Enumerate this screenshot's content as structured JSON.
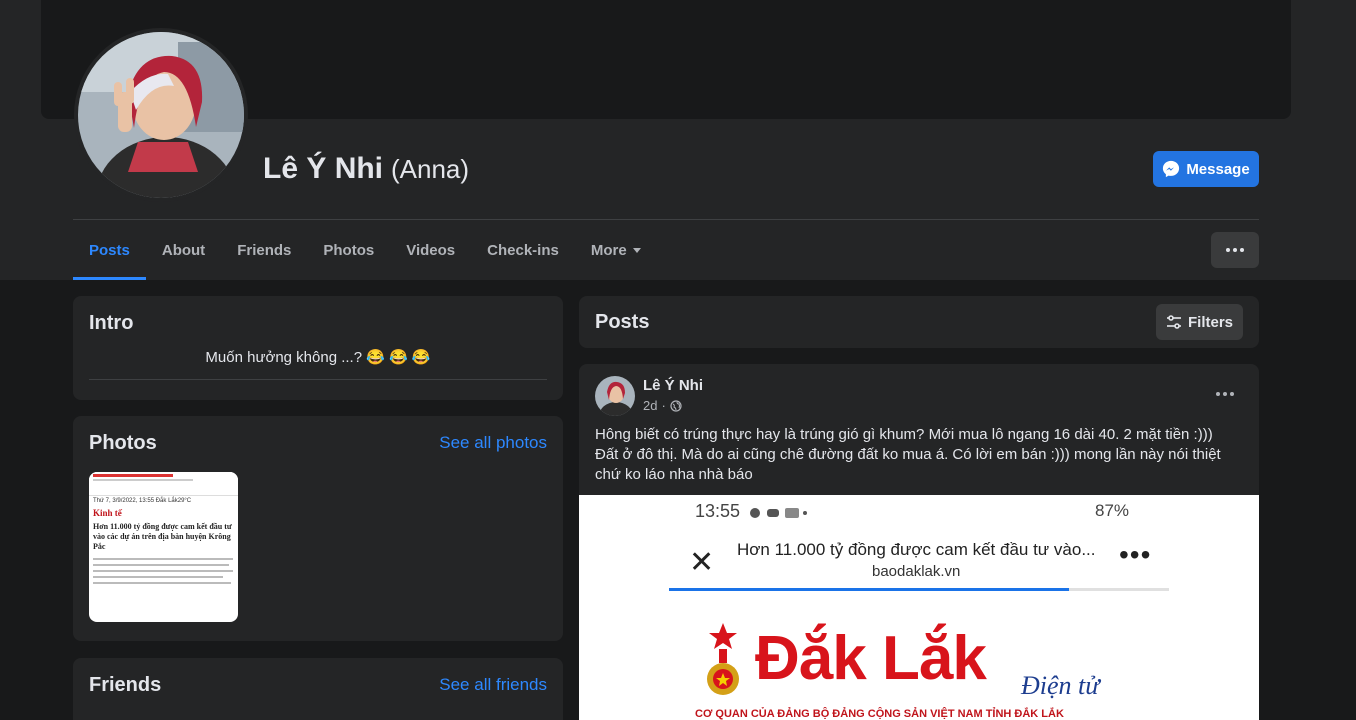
{
  "profile": {
    "name": "Lê Ý Nhi",
    "alt_name": "(Anna)",
    "message_label": "Message"
  },
  "tabs": [
    {
      "label": "Posts",
      "active": true
    },
    {
      "label": "About"
    },
    {
      "label": "Friends"
    },
    {
      "label": "Photos"
    },
    {
      "label": "Videos"
    },
    {
      "label": "Check-ins"
    },
    {
      "label": "More"
    }
  ],
  "intro": {
    "title": "Intro",
    "bio": "Muốn hưởng không ...? 😂 😂 😂"
  },
  "photos": {
    "title": "Photos",
    "see_all": "See all photos",
    "thumb_header": "Thứ 7, 3/9/2022, 13:55  Đắk Lắk29°C",
    "thumb_section": "Kinh tế",
    "thumb_headline": "Hơn 11.000 tỷ đồng được cam kết đầu tư vào các dự án trên địa bàn huyện Krông Pắc"
  },
  "friends": {
    "title": "Friends",
    "see_all": "See all friends"
  },
  "posts_header": {
    "title": "Posts",
    "filters_label": "Filters"
  },
  "post": {
    "author": "Lê Ý Nhi",
    "time": "2d",
    "text": "Hông biết có trúng thực hay là trúng gió gì khum? Mới mua lô ngang 16 dài 40. 2 mặt tiền :))) Đất ở đô thị. Mà do ai cũng chê đường đất ko mua á. Có lời em bán :)))  mong lần này nói thiệt chứ ko láo nha nhà báo",
    "image": {
      "status_time": "13:55",
      "status_right": "87%",
      "page_title": "Hơn 11.000 tỷ đồng được cam kết đầu tư vào...",
      "domain": "baodaklak.vn",
      "logo": "Đắk Lắk",
      "logo_tag": "Điện tử",
      "org": "CƠ QUAN CỦA ĐẢNG BỘ ĐẢNG CỘNG SẢN VIỆT NAM TỈNH ĐẮK LẮK"
    }
  },
  "colors": {
    "accent": "#2d88ff",
    "button": "#2374e1",
    "surface": "#242526",
    "background": "#18191a"
  }
}
